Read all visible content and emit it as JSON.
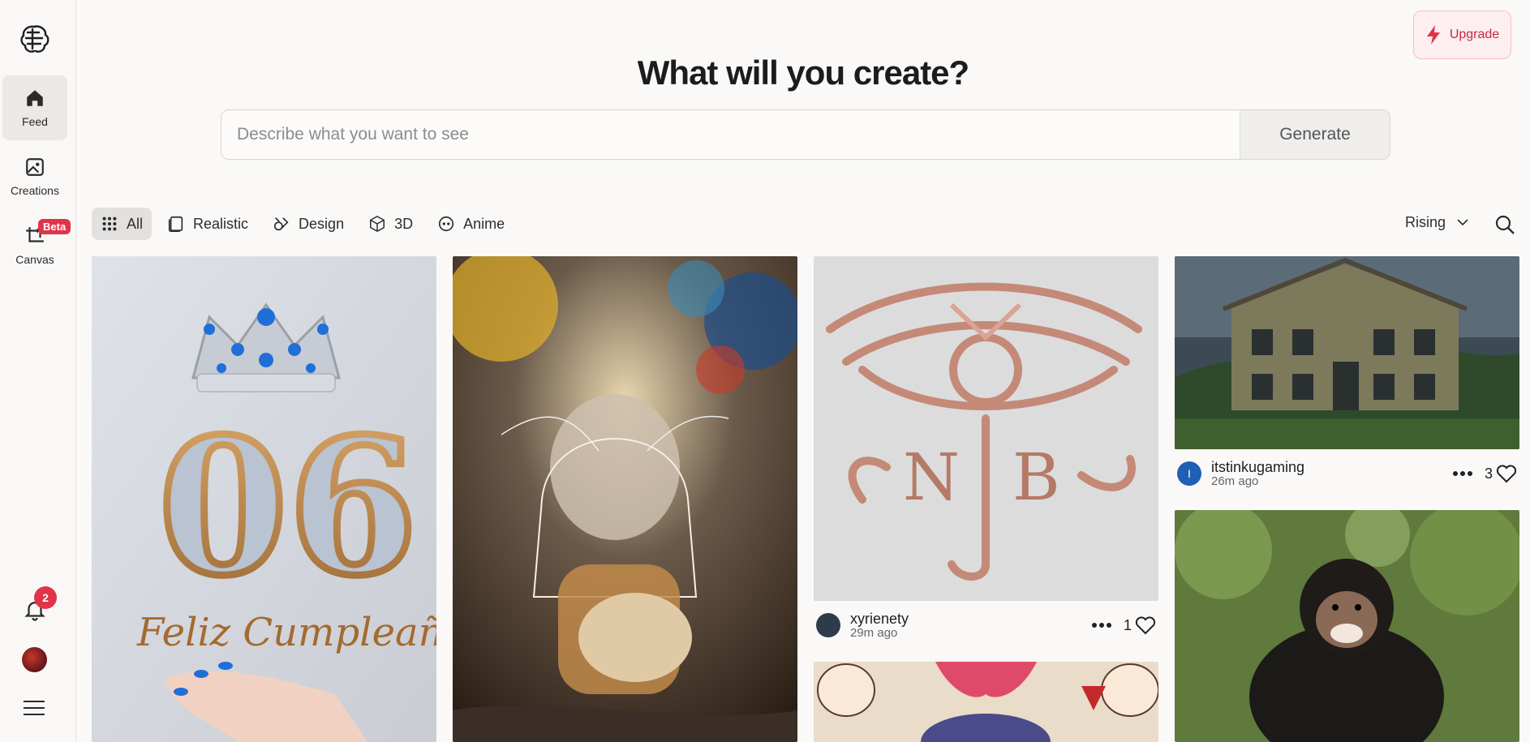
{
  "sidebar": {
    "items": [
      {
        "label": "Feed",
        "icon": "home-icon"
      },
      {
        "label": "Creations",
        "icon": "image-icon"
      },
      {
        "label": "Canvas",
        "icon": "canvas-icon"
      }
    ],
    "beta_badge": "Beta",
    "notification_count": "2"
  },
  "header": {
    "upgrade_label": "Upgrade",
    "headline": "What will you create?",
    "prompt_placeholder": "Describe what you want to see",
    "generate_label": "Generate"
  },
  "filters": {
    "items": [
      {
        "label": "All",
        "icon": "grid-icon"
      },
      {
        "label": "Realistic",
        "icon": "photo-icon"
      },
      {
        "label": "Design",
        "icon": "design-icon"
      },
      {
        "label": "3D",
        "icon": "cube-icon"
      },
      {
        "label": "Anime",
        "icon": "anime-face-icon"
      }
    ],
    "active": "All",
    "sort_label": "Rising"
  },
  "cards": [
    {
      "title": "Feliz Cumpleaños",
      "badge": "06"
    },
    {
      "user": "xyrienety",
      "time": "29m ago",
      "likes": "1"
    },
    {
      "user": "itstinkugaming",
      "time": "26m ago",
      "likes": "3",
      "avatar_letter": "I"
    }
  ],
  "colors": {
    "accent": "#e0344b",
    "upgrade_text": "#c52a3e",
    "avatar_blue": "#1f5fb4"
  }
}
